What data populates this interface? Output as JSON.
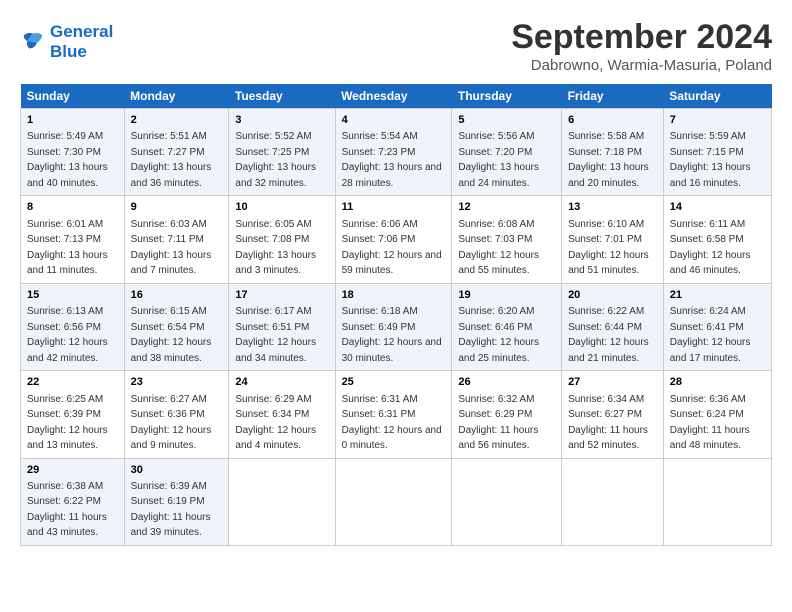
{
  "logo": {
    "line1": "General",
    "line2": "Blue"
  },
  "title": "September 2024",
  "subtitle": "Dabrowno, Warmia-Masuria, Poland",
  "weekdays": [
    "Sunday",
    "Monday",
    "Tuesday",
    "Wednesday",
    "Thursday",
    "Friday",
    "Saturday"
  ],
  "weeks": [
    [
      {
        "day": "1",
        "sunrise": "5:49 AM",
        "sunset": "7:30 PM",
        "daylight": "13 hours and 40 minutes."
      },
      {
        "day": "2",
        "sunrise": "5:51 AM",
        "sunset": "7:27 PM",
        "daylight": "13 hours and 36 minutes."
      },
      {
        "day": "3",
        "sunrise": "5:52 AM",
        "sunset": "7:25 PM",
        "daylight": "13 hours and 32 minutes."
      },
      {
        "day": "4",
        "sunrise": "5:54 AM",
        "sunset": "7:23 PM",
        "daylight": "13 hours and 28 minutes."
      },
      {
        "day": "5",
        "sunrise": "5:56 AM",
        "sunset": "7:20 PM",
        "daylight": "13 hours and 24 minutes."
      },
      {
        "day": "6",
        "sunrise": "5:58 AM",
        "sunset": "7:18 PM",
        "daylight": "13 hours and 20 minutes."
      },
      {
        "day": "7",
        "sunrise": "5:59 AM",
        "sunset": "7:15 PM",
        "daylight": "13 hours and 16 minutes."
      }
    ],
    [
      {
        "day": "8",
        "sunrise": "6:01 AM",
        "sunset": "7:13 PM",
        "daylight": "13 hours and 11 minutes."
      },
      {
        "day": "9",
        "sunrise": "6:03 AM",
        "sunset": "7:11 PM",
        "daylight": "13 hours and 7 minutes."
      },
      {
        "day": "10",
        "sunrise": "6:05 AM",
        "sunset": "7:08 PM",
        "daylight": "13 hours and 3 minutes."
      },
      {
        "day": "11",
        "sunrise": "6:06 AM",
        "sunset": "7:06 PM",
        "daylight": "12 hours and 59 minutes."
      },
      {
        "day": "12",
        "sunrise": "6:08 AM",
        "sunset": "7:03 PM",
        "daylight": "12 hours and 55 minutes."
      },
      {
        "day": "13",
        "sunrise": "6:10 AM",
        "sunset": "7:01 PM",
        "daylight": "12 hours and 51 minutes."
      },
      {
        "day": "14",
        "sunrise": "6:11 AM",
        "sunset": "6:58 PM",
        "daylight": "12 hours and 46 minutes."
      }
    ],
    [
      {
        "day": "15",
        "sunrise": "6:13 AM",
        "sunset": "6:56 PM",
        "daylight": "12 hours and 42 minutes."
      },
      {
        "day": "16",
        "sunrise": "6:15 AM",
        "sunset": "6:54 PM",
        "daylight": "12 hours and 38 minutes."
      },
      {
        "day": "17",
        "sunrise": "6:17 AM",
        "sunset": "6:51 PM",
        "daylight": "12 hours and 34 minutes."
      },
      {
        "day": "18",
        "sunrise": "6:18 AM",
        "sunset": "6:49 PM",
        "daylight": "12 hours and 30 minutes."
      },
      {
        "day": "19",
        "sunrise": "6:20 AM",
        "sunset": "6:46 PM",
        "daylight": "12 hours and 25 minutes."
      },
      {
        "day": "20",
        "sunrise": "6:22 AM",
        "sunset": "6:44 PM",
        "daylight": "12 hours and 21 minutes."
      },
      {
        "day": "21",
        "sunrise": "6:24 AM",
        "sunset": "6:41 PM",
        "daylight": "12 hours and 17 minutes."
      }
    ],
    [
      {
        "day": "22",
        "sunrise": "6:25 AM",
        "sunset": "6:39 PM",
        "daylight": "12 hours and 13 minutes."
      },
      {
        "day": "23",
        "sunrise": "6:27 AM",
        "sunset": "6:36 PM",
        "daylight": "12 hours and 9 minutes."
      },
      {
        "day": "24",
        "sunrise": "6:29 AM",
        "sunset": "6:34 PM",
        "daylight": "12 hours and 4 minutes."
      },
      {
        "day": "25",
        "sunrise": "6:31 AM",
        "sunset": "6:31 PM",
        "daylight": "12 hours and 0 minutes."
      },
      {
        "day": "26",
        "sunrise": "6:32 AM",
        "sunset": "6:29 PM",
        "daylight": "11 hours and 56 minutes."
      },
      {
        "day": "27",
        "sunrise": "6:34 AM",
        "sunset": "6:27 PM",
        "daylight": "11 hours and 52 minutes."
      },
      {
        "day": "28",
        "sunrise": "6:36 AM",
        "sunset": "6:24 PM",
        "daylight": "11 hours and 48 minutes."
      }
    ],
    [
      {
        "day": "29",
        "sunrise": "6:38 AM",
        "sunset": "6:22 PM",
        "daylight": "11 hours and 43 minutes."
      },
      {
        "day": "30",
        "sunrise": "6:39 AM",
        "sunset": "6:19 PM",
        "daylight": "11 hours and 39 minutes."
      },
      null,
      null,
      null,
      null,
      null
    ]
  ],
  "labels": {
    "sunrise": "Sunrise:",
    "sunset": "Sunset:",
    "daylight": "Daylight:"
  }
}
